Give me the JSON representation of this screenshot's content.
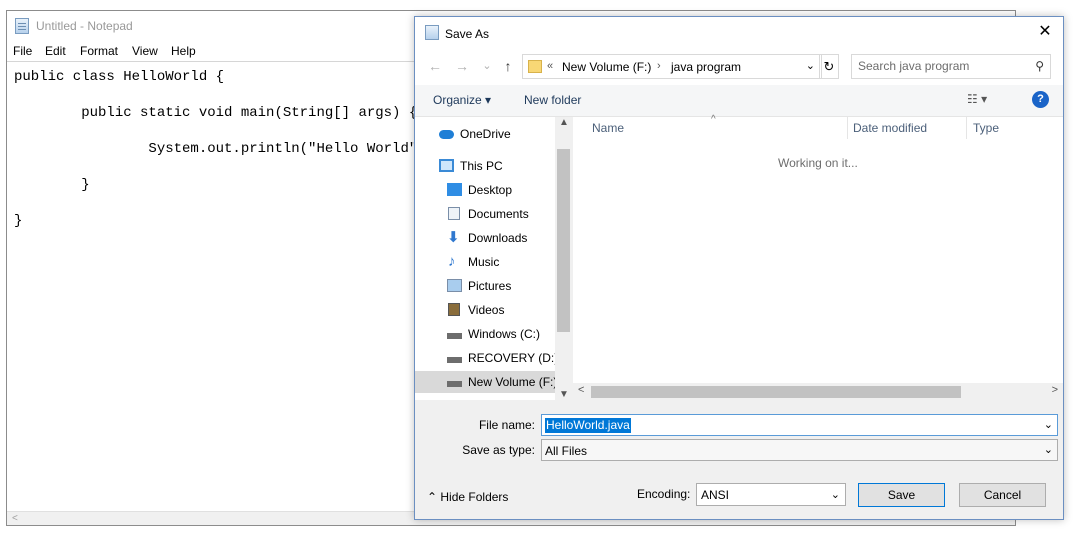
{
  "notepad": {
    "title": "Untitled - Notepad",
    "menu": [
      "File",
      "Edit",
      "Format",
      "View",
      "Help"
    ],
    "code": "public class HelloWorld {\n\n        public static void main(String[] args) {\n\n                System.out.println(\"Hello World\");\n\n        }\n\n}",
    "scroll_left": "<"
  },
  "dialog": {
    "title": "Save As",
    "close": "✕",
    "nav": {
      "back": "←",
      "forward": "→",
      "recent": "⌄",
      "up": "↑"
    },
    "address": {
      "overflow": "«",
      "crumb1": "New Volume (F:)",
      "sep": "›",
      "crumb2": "java program",
      "dropdown": "⌄",
      "refresh": "↻"
    },
    "search": {
      "placeholder": "Search java program",
      "icon": "search-icon"
    },
    "toolbar": {
      "organize": "Organize ▾",
      "new_folder": "New folder",
      "view": "☷ ▾",
      "help": "?"
    },
    "nav_pane": {
      "items": [
        {
          "label": "OneDrive",
          "icon": "onedrive-icon"
        },
        {
          "label": "This PC",
          "icon": "pc-icon"
        },
        {
          "label": "Desktop",
          "icon": "desktop-icon"
        },
        {
          "label": "Documents",
          "icon": "documents-icon"
        },
        {
          "label": "Downloads",
          "icon": "downloads-icon"
        },
        {
          "label": "Music",
          "icon": "music-icon"
        },
        {
          "label": "Pictures",
          "icon": "pictures-icon"
        },
        {
          "label": "Videos",
          "icon": "videos-icon"
        },
        {
          "label": "Windows (C:)",
          "icon": "drive-icon"
        },
        {
          "label": "RECOVERY (D:)",
          "icon": "drive-icon"
        },
        {
          "label": "New Volume (F:)",
          "icon": "drive-icon"
        }
      ],
      "scroll_up": "▲",
      "scroll_down": "▼"
    },
    "file_pane": {
      "columns": [
        "Name",
        "Date modified",
        "Type"
      ],
      "sort_caret": "^",
      "status": "Working on it...",
      "scroll_left": "<",
      "scroll_right": ">"
    },
    "fields": {
      "filename_label": "File name:",
      "filename_value": "HelloWorld.java",
      "savetype_label": "Save as type:",
      "savetype_value": "All Files",
      "dropdown": "⌄"
    },
    "footer": {
      "hide_folders": "⌃  Hide Folders",
      "encoding_label": "Encoding:",
      "encoding_value": "ANSI",
      "save": "Save",
      "cancel": "Cancel"
    },
    "colors": {
      "accent": "#0078d7",
      "border": "#6b8fc1",
      "link": "#1e395b"
    }
  }
}
